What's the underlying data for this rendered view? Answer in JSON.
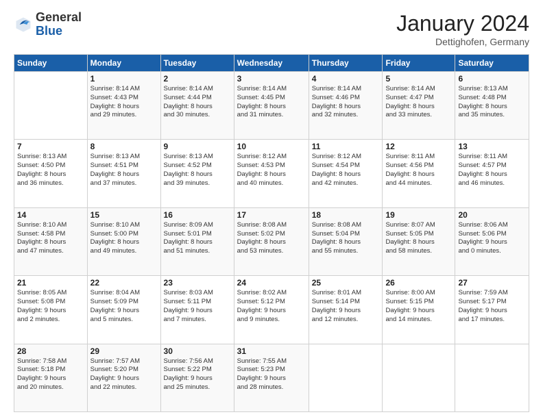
{
  "header": {
    "logo_general": "General",
    "logo_blue": "Blue",
    "month_title": "January 2024",
    "location": "Dettighofen, Germany"
  },
  "days_of_week": [
    "Sunday",
    "Monday",
    "Tuesday",
    "Wednesday",
    "Thursday",
    "Friday",
    "Saturday"
  ],
  "weeks": [
    [
      {
        "day": "",
        "info": ""
      },
      {
        "day": "1",
        "info": "Sunrise: 8:14 AM\nSunset: 4:43 PM\nDaylight: 8 hours\nand 29 minutes."
      },
      {
        "day": "2",
        "info": "Sunrise: 8:14 AM\nSunset: 4:44 PM\nDaylight: 8 hours\nand 30 minutes."
      },
      {
        "day": "3",
        "info": "Sunrise: 8:14 AM\nSunset: 4:45 PM\nDaylight: 8 hours\nand 31 minutes."
      },
      {
        "day": "4",
        "info": "Sunrise: 8:14 AM\nSunset: 4:46 PM\nDaylight: 8 hours\nand 32 minutes."
      },
      {
        "day": "5",
        "info": "Sunrise: 8:14 AM\nSunset: 4:47 PM\nDaylight: 8 hours\nand 33 minutes."
      },
      {
        "day": "6",
        "info": "Sunrise: 8:13 AM\nSunset: 4:48 PM\nDaylight: 8 hours\nand 35 minutes."
      }
    ],
    [
      {
        "day": "7",
        "info": "Sunrise: 8:13 AM\nSunset: 4:50 PM\nDaylight: 8 hours\nand 36 minutes."
      },
      {
        "day": "8",
        "info": "Sunrise: 8:13 AM\nSunset: 4:51 PM\nDaylight: 8 hours\nand 37 minutes."
      },
      {
        "day": "9",
        "info": "Sunrise: 8:13 AM\nSunset: 4:52 PM\nDaylight: 8 hours\nand 39 minutes."
      },
      {
        "day": "10",
        "info": "Sunrise: 8:12 AM\nSunset: 4:53 PM\nDaylight: 8 hours\nand 40 minutes."
      },
      {
        "day": "11",
        "info": "Sunrise: 8:12 AM\nSunset: 4:54 PM\nDaylight: 8 hours\nand 42 minutes."
      },
      {
        "day": "12",
        "info": "Sunrise: 8:11 AM\nSunset: 4:56 PM\nDaylight: 8 hours\nand 44 minutes."
      },
      {
        "day": "13",
        "info": "Sunrise: 8:11 AM\nSunset: 4:57 PM\nDaylight: 8 hours\nand 46 minutes."
      }
    ],
    [
      {
        "day": "14",
        "info": "Sunrise: 8:10 AM\nSunset: 4:58 PM\nDaylight: 8 hours\nand 47 minutes."
      },
      {
        "day": "15",
        "info": "Sunrise: 8:10 AM\nSunset: 5:00 PM\nDaylight: 8 hours\nand 49 minutes."
      },
      {
        "day": "16",
        "info": "Sunrise: 8:09 AM\nSunset: 5:01 PM\nDaylight: 8 hours\nand 51 minutes."
      },
      {
        "day": "17",
        "info": "Sunrise: 8:08 AM\nSunset: 5:02 PM\nDaylight: 8 hours\nand 53 minutes."
      },
      {
        "day": "18",
        "info": "Sunrise: 8:08 AM\nSunset: 5:04 PM\nDaylight: 8 hours\nand 55 minutes."
      },
      {
        "day": "19",
        "info": "Sunrise: 8:07 AM\nSunset: 5:05 PM\nDaylight: 8 hours\nand 58 minutes."
      },
      {
        "day": "20",
        "info": "Sunrise: 8:06 AM\nSunset: 5:06 PM\nDaylight: 9 hours\nand 0 minutes."
      }
    ],
    [
      {
        "day": "21",
        "info": "Sunrise: 8:05 AM\nSunset: 5:08 PM\nDaylight: 9 hours\nand 2 minutes."
      },
      {
        "day": "22",
        "info": "Sunrise: 8:04 AM\nSunset: 5:09 PM\nDaylight: 9 hours\nand 5 minutes."
      },
      {
        "day": "23",
        "info": "Sunrise: 8:03 AM\nSunset: 5:11 PM\nDaylight: 9 hours\nand 7 minutes."
      },
      {
        "day": "24",
        "info": "Sunrise: 8:02 AM\nSunset: 5:12 PM\nDaylight: 9 hours\nand 9 minutes."
      },
      {
        "day": "25",
        "info": "Sunrise: 8:01 AM\nSunset: 5:14 PM\nDaylight: 9 hours\nand 12 minutes."
      },
      {
        "day": "26",
        "info": "Sunrise: 8:00 AM\nSunset: 5:15 PM\nDaylight: 9 hours\nand 14 minutes."
      },
      {
        "day": "27",
        "info": "Sunrise: 7:59 AM\nSunset: 5:17 PM\nDaylight: 9 hours\nand 17 minutes."
      }
    ],
    [
      {
        "day": "28",
        "info": "Sunrise: 7:58 AM\nSunset: 5:18 PM\nDaylight: 9 hours\nand 20 minutes."
      },
      {
        "day": "29",
        "info": "Sunrise: 7:57 AM\nSunset: 5:20 PM\nDaylight: 9 hours\nand 22 minutes."
      },
      {
        "day": "30",
        "info": "Sunrise: 7:56 AM\nSunset: 5:22 PM\nDaylight: 9 hours\nand 25 minutes."
      },
      {
        "day": "31",
        "info": "Sunrise: 7:55 AM\nSunset: 5:23 PM\nDaylight: 9 hours\nand 28 minutes."
      },
      {
        "day": "",
        "info": ""
      },
      {
        "day": "",
        "info": ""
      },
      {
        "day": "",
        "info": ""
      }
    ]
  ]
}
